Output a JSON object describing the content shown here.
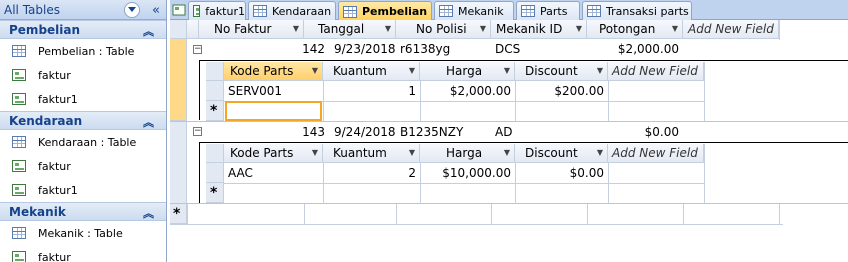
{
  "nav": {
    "title": "All Tables",
    "groups": [
      {
        "name": "Pembelian",
        "items": [
          {
            "label": "Pembelian : Table",
            "icon": "table-icon"
          },
          {
            "label": "faktur",
            "icon": "form-icon"
          },
          {
            "label": "faktur1",
            "icon": "form-icon"
          }
        ]
      },
      {
        "name": "Kendaraan",
        "items": [
          {
            "label": "Kendaraan : Table",
            "icon": "table-icon"
          },
          {
            "label": "faktur",
            "icon": "form-icon"
          },
          {
            "label": "faktur1",
            "icon": "form-icon"
          }
        ]
      },
      {
        "name": "Mekanik",
        "items": [
          {
            "label": "Mekanik : Table",
            "icon": "table-icon"
          },
          {
            "label": "faktur",
            "icon": "form-icon"
          }
        ]
      }
    ]
  },
  "tabs": [
    {
      "label": "faktur1",
      "icon": "form-icon"
    },
    {
      "label": "Kendaraan",
      "icon": "table-icon"
    },
    {
      "label": "Pembelian",
      "icon": "table-icon",
      "active": true
    },
    {
      "label": "Mekanik",
      "icon": "table-icon"
    },
    {
      "label": "Parts",
      "icon": "table-icon"
    },
    {
      "label": "Transaksi parts",
      "icon": "table-icon"
    }
  ],
  "main": {
    "columns": [
      "No Faktur",
      "Tanggal",
      "No Polisi",
      "Mekanik ID",
      "Potongan",
      "Add New Field"
    ],
    "rows": [
      {
        "no_faktur": "142",
        "tanggal": "9/23/2018",
        "no_polisi": "r6138yg",
        "mekanik_id": "DCS",
        "potongan": "$2,000.00",
        "sub": {
          "columns": [
            "Kode Parts",
            "Kuantum",
            "Harga",
            "Discount",
            "Add New Field"
          ],
          "rows": [
            {
              "kode_parts": "SERV001",
              "kuantum": "1",
              "harga": "$2,000.00",
              "discount": "$200.00"
            }
          ]
        }
      },
      {
        "no_faktur": "143",
        "tanggal": "9/24/2018",
        "no_polisi": "B1235NZY",
        "mekanik_id": "AD",
        "potongan": "$0.00",
        "sub": {
          "columns": [
            "Kode Parts",
            "Kuantum",
            "Harga",
            "Discount",
            "Add New Field"
          ],
          "rows": [
            {
              "kode_parts": "AAC",
              "kuantum": "2",
              "harga": "$10,000.00",
              "discount": "$0.00"
            }
          ]
        }
      }
    ],
    "new_row_marker": "*",
    "expander_symbol": "−"
  },
  "colors": {
    "accent": "#ffd25a",
    "header_bg": "#e3e9f3",
    "nav_text": "#15428b",
    "grid": "#c5d0df"
  }
}
